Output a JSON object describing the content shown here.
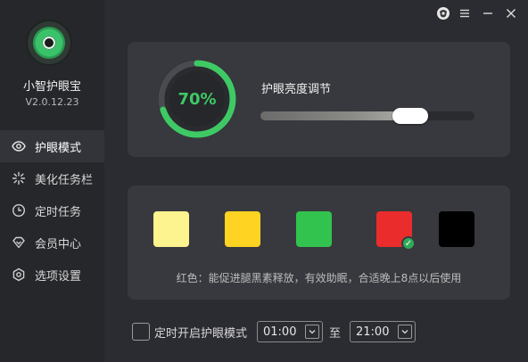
{
  "app": {
    "name": "小智护眼宝",
    "version": "V2.0.12.23"
  },
  "titlebar": {
    "skin": "skin-icon",
    "menu": "menu-icon",
    "minimize": "minimize-icon",
    "close": "close-icon"
  },
  "nav": [
    {
      "label": "护眼模式",
      "icon": "eye-icon",
      "active": true
    },
    {
      "label": "美化任务栏",
      "icon": "sparkle-icon",
      "active": false
    },
    {
      "label": "定时任务",
      "icon": "clock-icon",
      "active": false
    },
    {
      "label": "会员中心",
      "icon": "diamond-icon",
      "active": false
    },
    {
      "label": "选项设置",
      "icon": "gear-icon",
      "active": false
    }
  ],
  "brightness": {
    "label": "护眼亮度调节",
    "value_text": "70%",
    "level": 0.7,
    "slider_level": 0.78
  },
  "colors": {
    "swatches": [
      {
        "name": "yellow-light",
        "hex": "#fdf38f",
        "selected": false
      },
      {
        "name": "yellow",
        "hex": "#fed322",
        "selected": false
      },
      {
        "name": "green",
        "hex": "#32c34e",
        "selected": false
      },
      {
        "name": "red",
        "hex": "#ea2c2c",
        "selected": true
      },
      {
        "name": "black",
        "hex": "#000000",
        "selected": false
      }
    ],
    "description": "红色：能促进腿黑素释放，有效助眠，合适晚上8点以后使用"
  },
  "timer": {
    "checkbox_label": "定时开启护眼模式",
    "checked": false,
    "start": "01:00",
    "to": "至",
    "end": "21:00"
  },
  "theme": {
    "accent": "#3ec965",
    "bg": "#2b2c31",
    "panel": "#38393e"
  }
}
